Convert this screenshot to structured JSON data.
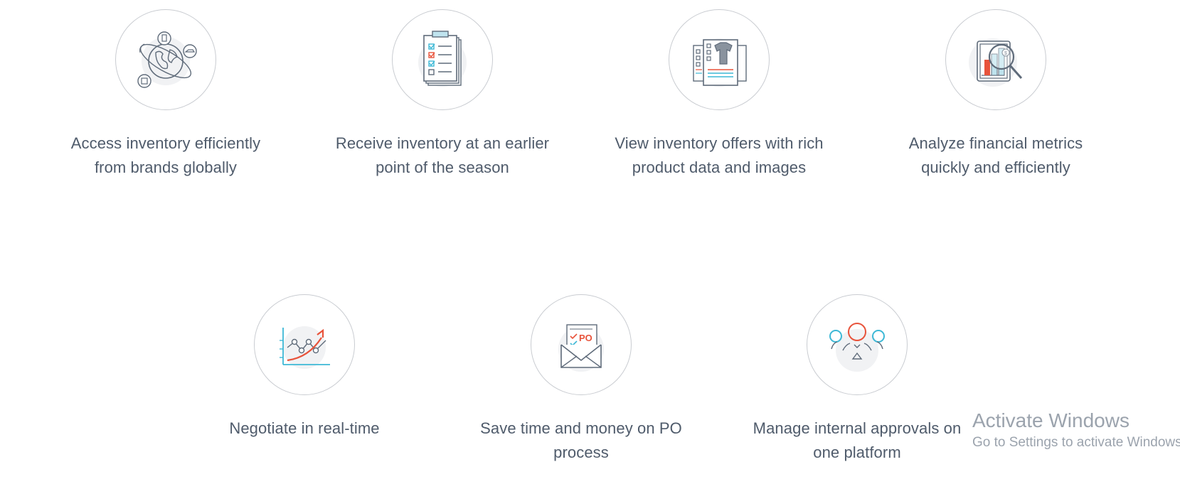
{
  "features": [
    {
      "caption": "Access inventory efficiently\nfrom brands globally",
      "icon": "globe-shipping-icon"
    },
    {
      "caption": "Receive inventory at an earlier\npoint of the season",
      "icon": "clipboard-checklist-icon"
    },
    {
      "caption": "View inventory offers with rich\nproduct data and images",
      "icon": "product-catalog-icon"
    },
    {
      "caption": "Analyze financial metrics\nquickly and efficiently",
      "icon": "magnifier-chart-icon"
    },
    {
      "caption": "Negotiate in real-time",
      "icon": "trend-line-chart-icon"
    },
    {
      "caption": "Save time and money on PO\nprocess",
      "icon": "po-envelope-icon"
    },
    {
      "caption": "Manage internal approvals on\none platform",
      "icon": "team-approval-icon"
    }
  ],
  "watermark": {
    "title": "Activate Windows",
    "subtitle": "Go to Settings to activate Windows."
  },
  "colors": {
    "line": "#5f6b7a",
    "accent_red": "#e8533b",
    "accent_blue": "#3db8d6",
    "circle_border": "#c9ccd1"
  }
}
